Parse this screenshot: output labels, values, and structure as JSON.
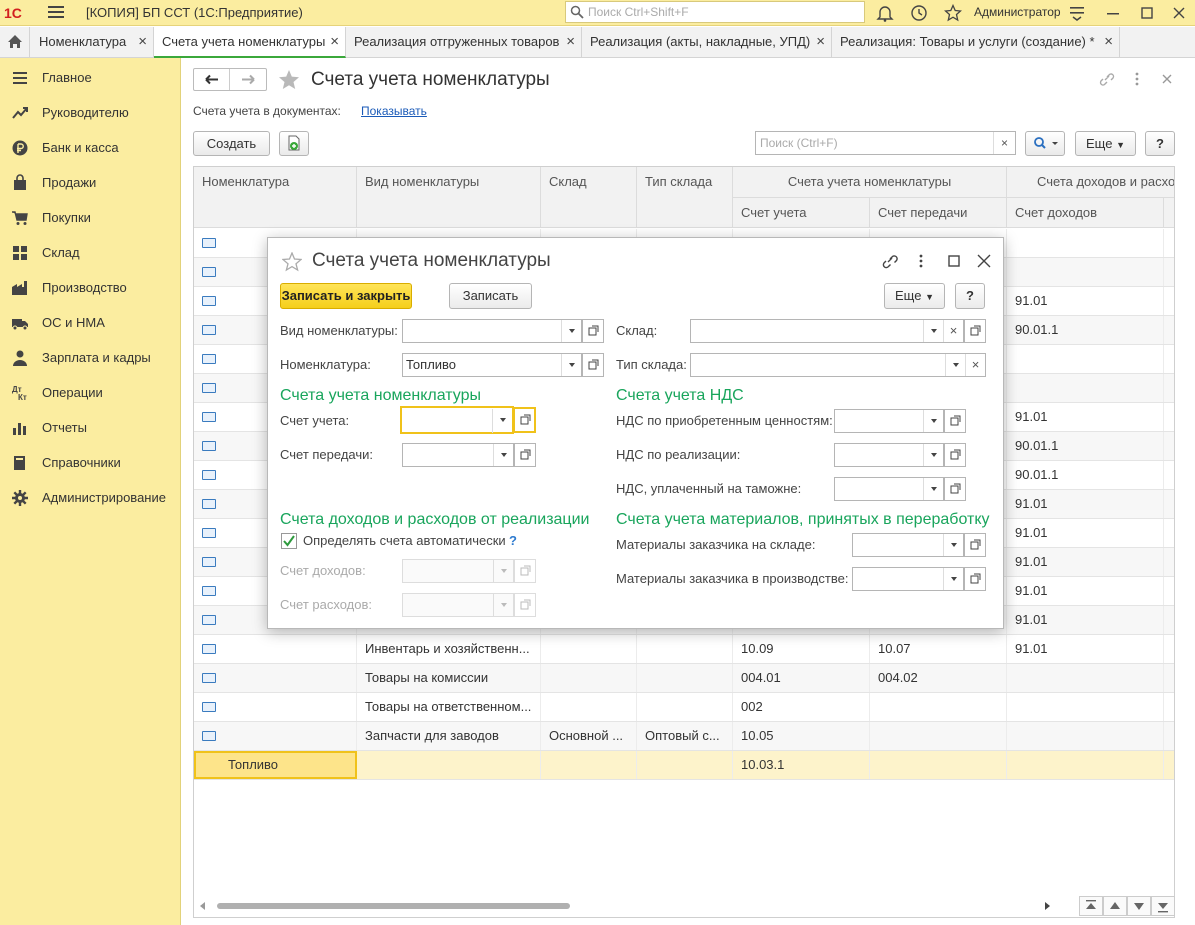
{
  "app": {
    "logo": "1С",
    "title": "[КОПИЯ] БП ССТ  (1С:Предприятие)",
    "search_placeholder": "Поиск Ctrl+Shift+F",
    "user": "Администратор"
  },
  "tabs": [
    {
      "label": "Номенклатура"
    },
    {
      "label": "Счета учета номенклатуры",
      "active": true
    },
    {
      "label": "Реализация отгруженных товаров"
    },
    {
      "label": "Реализация (акты, накладные, УПД)"
    },
    {
      "label": "Реализация: Товары и услуги (создание) *"
    }
  ],
  "sidebar": [
    {
      "label": "Главное",
      "icon": "menu-icon"
    },
    {
      "label": "Руководителю",
      "icon": "trend-icon"
    },
    {
      "label": "Банк и касса",
      "icon": "ruble-icon"
    },
    {
      "label": "Продажи",
      "icon": "bag-icon"
    },
    {
      "label": "Покупки",
      "icon": "cart-icon"
    },
    {
      "label": "Склад",
      "icon": "warehouse-icon"
    },
    {
      "label": "Производство",
      "icon": "factory-icon"
    },
    {
      "label": "ОС и НМА",
      "icon": "truck-icon"
    },
    {
      "label": "Зарплата и кадры",
      "icon": "person-icon"
    },
    {
      "label": "Операции",
      "icon": "dt-kt-icon"
    },
    {
      "label": "Отчеты",
      "icon": "bar-chart-icon"
    },
    {
      "label": "Справочники",
      "icon": "book-icon"
    },
    {
      "label": "Администрирование",
      "icon": "gear-icon"
    }
  ],
  "page": {
    "title": "Счета учета номенклатуры",
    "accounts_label": "Счета учета в документах:",
    "accounts_link": "Показывать",
    "create": "Создать",
    "search_placeholder": "Поиск (Ctrl+F)",
    "more": "Еще",
    "help": "?"
  },
  "grid": {
    "headers": {
      "nomenclature": "Номенклатура",
      "kind": "Вид номенклатуры",
      "warehouse": "Склад",
      "warehouse_type": "Тип склада",
      "group1": "Счета учета номенклатуры",
      "account": "Счет учета",
      "transfer": "Счет передачи",
      "group2": "Счета доходов и расходов",
      "income": "Счет доходов"
    },
    "rows": [
      {
        "name": "",
        "kind": "",
        "wh": "",
        "wht": "",
        "acc": "",
        "tr": "",
        "inc": ""
      },
      {
        "name": "",
        "kind": "",
        "wh": "",
        "wht": "",
        "acc": "",
        "tr": "",
        "inc": ""
      },
      {
        "name": "",
        "kind": "",
        "wh": "",
        "wht": "",
        "acc": "",
        "tr": "",
        "inc": "91.01"
      },
      {
        "name": "",
        "kind": "",
        "wh": "",
        "wht": "",
        "acc": "",
        "tr": "",
        "inc": "90.01.1"
      },
      {
        "name": "",
        "kind": "",
        "wh": "",
        "wht": "",
        "acc": "",
        "tr": "",
        "inc": ""
      },
      {
        "name": "",
        "kind": "",
        "wh": "",
        "wht": "",
        "acc": "",
        "tr": "",
        "inc": ""
      },
      {
        "name": "",
        "kind": "",
        "wh": "",
        "wht": "",
        "acc": "",
        "tr": "",
        "inc": "91.01"
      },
      {
        "name": "",
        "kind": "",
        "wh": "",
        "wht": "",
        "acc": "",
        "tr": "",
        "inc": "90.01.1"
      },
      {
        "name": "",
        "kind": "",
        "wh": "",
        "wht": "",
        "acc": "",
        "tr": "",
        "inc": "90.01.1"
      },
      {
        "name": "",
        "kind": "",
        "wh": "",
        "wht": "",
        "acc": "",
        "tr": "",
        "inc": "91.01"
      },
      {
        "name": "",
        "kind": "",
        "wh": "",
        "wht": "",
        "acc": "",
        "tr": "",
        "inc": "91.01"
      },
      {
        "name": "",
        "kind": "",
        "wh": "",
        "wht": "",
        "acc": "",
        "tr": "",
        "inc": "91.01"
      },
      {
        "name": "",
        "kind": "",
        "wh": "",
        "wht": "",
        "acc": "",
        "tr": "",
        "inc": "91.01"
      },
      {
        "name": "",
        "kind": "",
        "wh": "",
        "wht": "",
        "acc": "",
        "tr": "",
        "inc": "91.01"
      },
      {
        "name": "",
        "kind": "Инвентарь и хозяйственн...",
        "wh": "",
        "wht": "",
        "acc": "10.09",
        "tr": "10.07",
        "inc": "91.01"
      },
      {
        "name": "",
        "kind": "Товары на комиссии",
        "wh": "",
        "wht": "",
        "acc": "004.01",
        "tr": "004.02",
        "inc": ""
      },
      {
        "name": "",
        "kind": "Товары на ответственном...",
        "wh": "",
        "wht": "",
        "acc": "002",
        "tr": "",
        "inc": ""
      },
      {
        "name": "",
        "kind": "Запчасти для заводов",
        "wh": "Основной ...",
        "wht": "Оптовый с...",
        "acc": "10.05",
        "tr": "",
        "inc": ""
      },
      {
        "name": "Топливо",
        "kind": "",
        "wh": "",
        "wht": "",
        "acc": "10.03.1",
        "tr": "",
        "inc": "",
        "selected": true
      }
    ]
  },
  "dialog": {
    "title": "Счета учета номенклатуры",
    "save_close": "Записать и закрыть",
    "save": "Записать",
    "more": "Еще",
    "help": "?",
    "kind_label": "Вид номенклатуры:",
    "kind_value": "",
    "nom_label": "Номенклатура:",
    "nom_value": "Топливо",
    "wh_label": "Склад:",
    "wh_value": "",
    "wht_label": "Тип склада:",
    "wht_value": "",
    "sec1": "Счета учета номенклатуры",
    "acc_label": "Счет учета:",
    "tr_label": "Счет передачи:",
    "sec2": "Счета учета НДС",
    "vat1_label": "НДС по приобретенным ценностям:",
    "vat2_label": "НДС по реализации:",
    "vat3_label": "НДС, уплаченный на таможне:",
    "sec3": "Счета доходов и расходов от реализации",
    "auto_label": "Определять счета автоматически",
    "auto_checked": true,
    "auto_help": "?",
    "inc_label": "Счет доходов:",
    "exp_label": "Счет расходов:",
    "sec4": "Счета учета материалов, принятых в переработку",
    "mat1_label": "Материалы заказчика на складе:",
    "mat2_label": "Материалы заказчика в производстве:"
  },
  "colors": {
    "accent": "#fbeda0",
    "section": "#19a55c",
    "primary_button": "#f5cf1b",
    "link": "#1a5ab8"
  }
}
